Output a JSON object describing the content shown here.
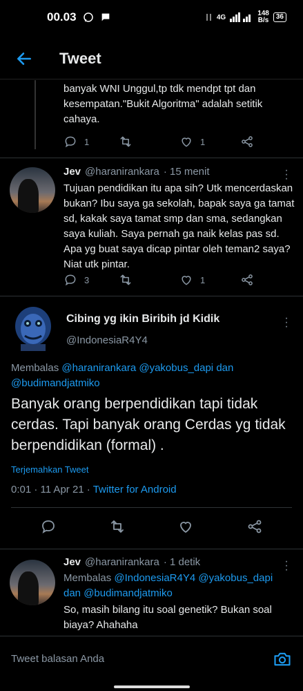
{
  "status_bar": {
    "time": "00.03",
    "network": "4G",
    "speed_value": "148",
    "speed_unit": "B/s",
    "battery": "36"
  },
  "header": {
    "title": "Tweet"
  },
  "reply_above": {
    "text_tail": "banyak WNI Unggul,tp tdk mendpt tpt dan kesempatan.\"Bukit Algoritma\" adalah setitik cahaya.",
    "reply_count": "1",
    "like_count": "1"
  },
  "jev_reply": {
    "name": "Jev",
    "handle": "@haranirankara",
    "time": "· 15 menit",
    "text": "Tujuan pendidikan itu apa sih? Utk mencerdaskan bukan? Ibu saya ga sekolah, bapak saya ga tamat sd, kakak saya tamat smp dan sma, sedangkan saya kuliah. Saya pernah ga naik kelas pas sd. Apa yg buat saya dicap pintar oleh teman2 saya? Niat utk pintar.",
    "reply_count": "3",
    "like_count": "1"
  },
  "main_tweet": {
    "name": "Cibing yg ikin Biribih jd Kidik",
    "handle": "@IndonesiaR4Y4",
    "replying_prefix": "Membalas",
    "replying_to_1": "@haranirankara",
    "replying_to_2": "@yakobus_dapi",
    "replying_and": "dan",
    "replying_to_3": "@budimandjatmiko",
    "text": "Banyak orang berpendidikan tapi tidak cerdas. Tapi banyak orang Cerdas yg tidak berpendidikan (formal) .",
    "translate_label": "Terjemahkan Tweet",
    "timestamp": "0:01 · 11 Apr 21 ·",
    "source": "Twitter for Android"
  },
  "jev_reply2": {
    "name": "Jev",
    "handle": "@haranirankara",
    "time": "· 1 detik",
    "replying_prefix": "Membalas",
    "replying_to_1": "@IndonesiaR4Y4",
    "replying_to_2": "@yakobus_dapi",
    "replying_and": "dan",
    "replying_to_3": "@budimandjatmiko",
    "text": "So, masih bilang itu soal genetik? Bukan soal biaya? Ahahaha"
  },
  "compose": {
    "placeholder": "Tweet balasan Anda"
  },
  "colors": {
    "accent": "#1d9bf0",
    "muted": "#8b98a5",
    "background": "#000000"
  }
}
